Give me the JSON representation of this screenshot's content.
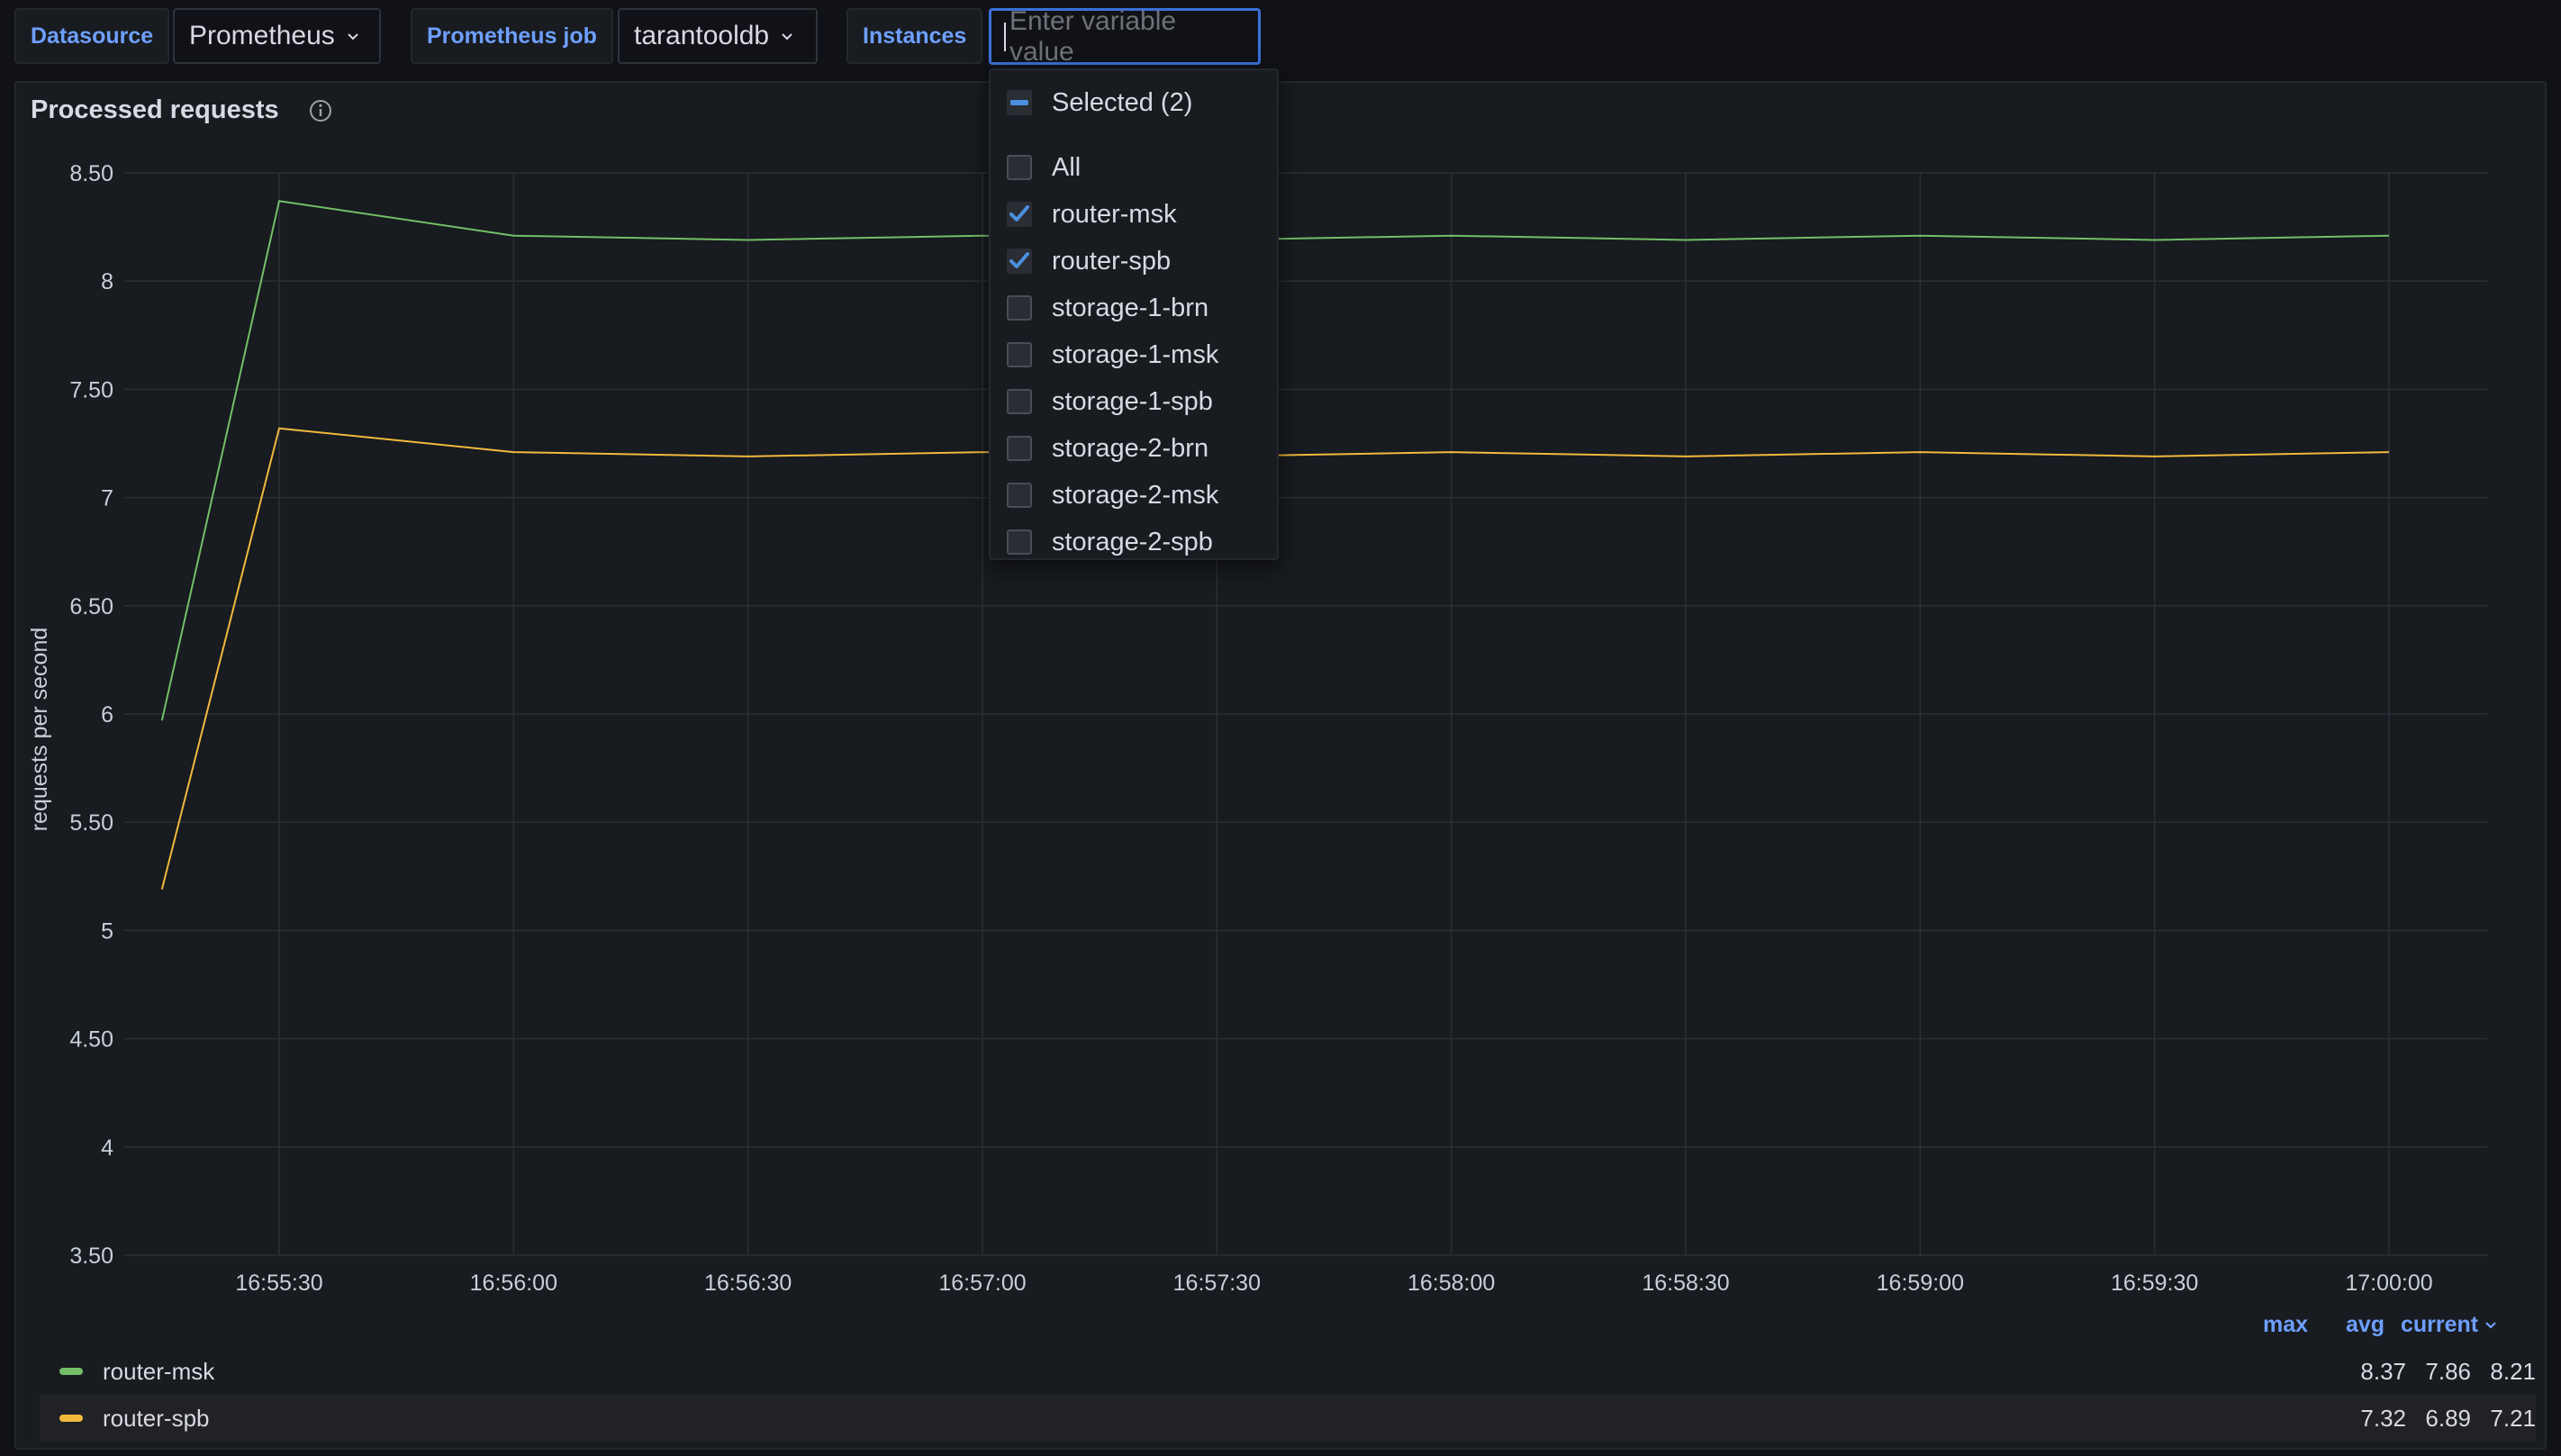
{
  "variables": {
    "datasource": {
      "label": "Datasource",
      "value": "Prometheus"
    },
    "job": {
      "label": "Prometheus job",
      "value": "tarantooldb"
    },
    "instances": {
      "label": "Instances",
      "placeholder": "Enter variable value"
    }
  },
  "dropdown": {
    "selected_label": "Selected (2)",
    "options": [
      {
        "label": "All",
        "checked": false
      },
      {
        "label": "router-msk",
        "checked": true
      },
      {
        "label": "router-spb",
        "checked": true
      },
      {
        "label": "storage-1-brn",
        "checked": false
      },
      {
        "label": "storage-1-msk",
        "checked": false
      },
      {
        "label": "storage-1-spb",
        "checked": false
      },
      {
        "label": "storage-2-brn",
        "checked": false
      },
      {
        "label": "storage-2-msk",
        "checked": false
      },
      {
        "label": "storage-2-spb",
        "checked": false
      }
    ]
  },
  "panel": {
    "title": "Processed requests"
  },
  "legend": {
    "headers": {
      "max": "max",
      "avg": "avg",
      "current": "current"
    },
    "rows": [
      {
        "name": "router-msk",
        "color": "#73bf69",
        "max": "8.37",
        "avg": "7.86",
        "current": "8.21"
      },
      {
        "name": "router-spb",
        "color": "#fade2a",
        "max": "7.32",
        "avg": "6.89",
        "current": "7.21"
      }
    ]
  },
  "chart_data": {
    "type": "line",
    "title": "Processed requests",
    "ylabel": "requests per second",
    "xlabel": "",
    "ylim": [
      3.5,
      8.5
    ],
    "y_ticks": [
      "3.50",
      "4",
      "4.50",
      "5",
      "5.50",
      "6",
      "6.50",
      "7",
      "7.50",
      "8",
      "8.50"
    ],
    "x_ticks": [
      "16:55:30",
      "16:56:00",
      "16:56:30",
      "16:57:00",
      "16:57:30",
      "16:58:00",
      "16:58:30",
      "16:59:00",
      "16:59:30",
      "17:00:00"
    ],
    "x": [
      "16:55:15",
      "16:55:30",
      "16:56:00",
      "16:56:30",
      "16:57:00",
      "16:57:30",
      "16:58:00",
      "16:58:30",
      "16:59:00",
      "16:59:30",
      "17:00:00"
    ],
    "series": [
      {
        "name": "router-msk",
        "color": "#73bf69",
        "values": [
          5.97,
          8.37,
          8.21,
          8.19,
          8.21,
          8.19,
          8.21,
          8.19,
          8.21,
          8.19,
          8.21
        ]
      },
      {
        "name": "router-spb",
        "color": "#f2b93d",
        "values": [
          5.19,
          7.32,
          7.21,
          7.19,
          7.21,
          7.19,
          7.21,
          7.19,
          7.21,
          7.19,
          7.21
        ]
      }
    ],
    "grid": true,
    "legend": "bottom"
  }
}
